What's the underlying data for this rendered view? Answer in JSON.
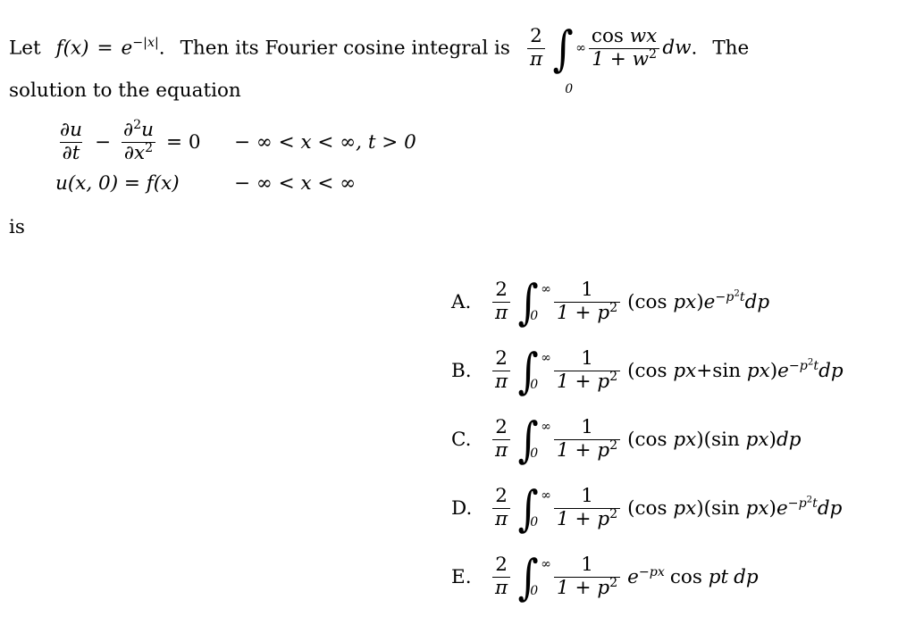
{
  "problem": {
    "intro": {
      "lead": "Let",
      "function_def": "f(x) = e^{-|x|}.",
      "f_name": "f",
      "f_arg": "(x)",
      "equals": "=",
      "e_base": "e",
      "exp_minus": "−",
      "exp_abs": "|x|",
      "period": ".",
      "sentence_mid": "Then its Fourier cosine integral is",
      "sentence_end": "The",
      "line2": "solution to the equation",
      "is_word": "is"
    },
    "cosine_integral": {
      "coef_num": "2",
      "coef_den": "π",
      "integral_upper": "∞",
      "integral_lower": "0",
      "frac_num": "cos wx",
      "frac_num_op": "cos",
      "frac_num_var": "wx",
      "frac_den": "1 + w",
      "frac_den_exp": "2",
      "differential": "dw",
      "period": "."
    },
    "pde": {
      "line1": {
        "term1_num": "∂u",
        "term1_den": "∂t",
        "minus": "−",
        "term2_num": "∂",
        "term2_num_exp": "2",
        "term2_num_var": "u",
        "term2_den": "∂x",
        "term2_den_exp": "2",
        "equals": "= 0",
        "condition": "− ∞ < x < ∞,  t > 0"
      },
      "line2": {
        "lhs": "u(x, 0) = f(x)",
        "condition": "− ∞ < x < ∞"
      }
    },
    "choices": [
      {
        "label": "A.",
        "coef_num": "2",
        "coef_den": "π",
        "upper": "∞",
        "lower": "0",
        "frac_num": "1",
        "frac_den": "1 + p",
        "frac_den_exp": "2",
        "body_open": "(",
        "op1": "cos",
        "arg1": "px",
        "body_close": ")",
        "has_plus": false,
        "plus": "",
        "op2": "",
        "arg2": "",
        "second_group": "",
        "exp_base": "e",
        "exp_minus": "−",
        "exp_var": "p",
        "exp_sq": "2",
        "exp_t": "t",
        "differential": "dp"
      },
      {
        "label": "B.",
        "coef_num": "2",
        "coef_den": "π",
        "upper": "∞",
        "lower": "0",
        "frac_num": "1",
        "frac_den": "1 + p",
        "frac_den_exp": "2",
        "body_open": "(",
        "op1": "cos",
        "arg1": "px",
        "body_close": ")",
        "has_plus": true,
        "plus": "+",
        "op2": "sin",
        "arg2": "px",
        "second_group": "",
        "exp_base": "e",
        "exp_minus": "−",
        "exp_var": "p",
        "exp_sq": "2",
        "exp_t": "t",
        "differential": "dp"
      },
      {
        "label": "C.",
        "coef_num": "2",
        "coef_den": "π",
        "upper": "∞",
        "lower": "0",
        "frac_num": "1",
        "frac_den": "1 + p",
        "frac_den_exp": "2",
        "body_open": "(",
        "op1": "cos",
        "arg1": "px",
        "body_close": ")",
        "has_plus": false,
        "plus": "",
        "op2": "sin",
        "arg2": "px",
        "second_group": "(sin px)",
        "exp_base": "",
        "exp_minus": "",
        "exp_var": "",
        "exp_sq": "",
        "exp_t": "",
        "differential": "dp"
      },
      {
        "label": "D.",
        "coef_num": "2",
        "coef_den": "π",
        "upper": "∞",
        "lower": "0",
        "frac_num": "1",
        "frac_den": "1 + p",
        "frac_den_exp": "2",
        "body_open": "(",
        "op1": "cos",
        "arg1": "px",
        "body_close": ")",
        "has_plus": false,
        "plus": "",
        "op2": "sin",
        "arg2": "px",
        "second_group": "(sin px)",
        "exp_base": "e",
        "exp_minus": "−",
        "exp_var": "p",
        "exp_sq": "2",
        "exp_t": "t",
        "differential": "dp"
      },
      {
        "label": "E.",
        "coef_num": "2",
        "coef_den": "π",
        "upper": "∞",
        "lower": "0",
        "frac_num": "1",
        "frac_den": "1 + p",
        "frac_den_exp": "2",
        "body_open": "",
        "op1": "cos",
        "arg1": "pt",
        "body_close": "",
        "has_plus": false,
        "plus": "",
        "op2": "",
        "arg2": "",
        "second_group": "",
        "exp_base": "e",
        "exp_minus": "−",
        "exp_var": "px",
        "exp_sq": "",
        "exp_t": "",
        "differential": "dp"
      }
    ]
  }
}
